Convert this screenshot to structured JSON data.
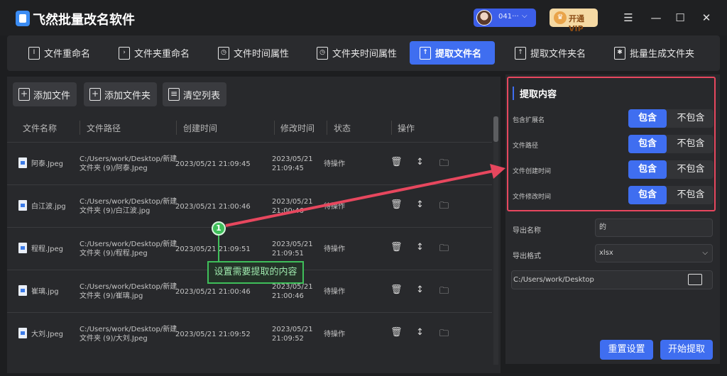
{
  "app": {
    "title": "飞然批量改名软件"
  },
  "user": {
    "id": "041···"
  },
  "vip": {
    "label": "开通VIP"
  },
  "window": {
    "minimize": "—",
    "maximize": "☐",
    "close": "✕",
    "menu": "☰"
  },
  "tabs": [
    {
      "label": "文件重命名"
    },
    {
      "label": "文件夹重命名"
    },
    {
      "label": "文件时间属性"
    },
    {
      "label": "文件夹时间属性"
    },
    {
      "label": "提取文件名"
    },
    {
      "label": "提取文件夹名"
    },
    {
      "label": "批量生成文件夹"
    }
  ],
  "toolbar": {
    "add_file": "添加文件",
    "add_folder": "添加文件夹",
    "clear_list": "清空列表"
  },
  "table": {
    "headers": {
      "name": "文件名称",
      "path": "文件路径",
      "created": "创建时间",
      "modified": "修改时间",
      "status": "状态",
      "action": "操作"
    },
    "rows": [
      {
        "name": "阿泰.Jpeg",
        "path1": "C:/Users/work/Desktop/新建",
        "path2": "文件夹 (9)/阿泰.Jpeg",
        "created": "2023/05/21 21:09:45",
        "mod1": "2023/05/21",
        "mod2": "21:09:45",
        "status": "待操作"
      },
      {
        "name": "白江波.jpg",
        "path1": "C:/Users/work/Desktop/新建",
        "path2": "文件夹 (9)/白江波.jpg",
        "created": "2023/05/21 21:00:46",
        "mod1": "2023/05/21",
        "mod2": "21:00:46",
        "status": "待操作"
      },
      {
        "name": "程程.Jpeg",
        "path1": "C:/Users/work/Desktop/新建",
        "path2": "文件夹 (9)/程程.Jpeg",
        "created": "2023/05/21 21:09:51",
        "mod1": "2023/05/21",
        "mod2": "21:09:51",
        "status": "待操作"
      },
      {
        "name": "崔璃.jpg",
        "path1": "C:/Users/work/Desktop/新建",
        "path2": "文件夹 (9)/崔璃.jpg",
        "created": "2023/05/21 21:00:46",
        "mod1": "2023/05/21",
        "mod2": "21:00:46",
        "status": "待操作"
      },
      {
        "name": "大刘.Jpeg",
        "path1": "C:/Users/work/Desktop/新建",
        "path2": "文件夹 (9)/大刘.Jpeg",
        "created": "2023/05/21 21:09:52",
        "mod1": "2023/05/21",
        "mod2": "21:09:52",
        "status": "待操作"
      }
    ],
    "actions": {
      "delete": "🗑",
      "move": "↕",
      "open": "🗀"
    }
  },
  "annotation": {
    "marker": "1",
    "callout": "设置需要提取的内容"
  },
  "extract": {
    "title": "提取内容",
    "options": [
      {
        "label": "包含扩展名",
        "on": "包含",
        "off": "不包含"
      },
      {
        "label": "文件路径",
        "on": "包含",
        "off": "不包含"
      },
      {
        "label": "文件创建时间",
        "on": "包含",
        "off": "不包含"
      },
      {
        "label": "文件修改时间",
        "on": "包含",
        "off": "不包含"
      }
    ],
    "export_name_label": "导出名称",
    "export_name_value": "的",
    "export_format_label": "导出格式",
    "export_format_value": "xlsx",
    "export_path": "C:/Users/work/Desktop"
  },
  "buttons": {
    "reset": "重置设置",
    "start": "开始提取"
  }
}
